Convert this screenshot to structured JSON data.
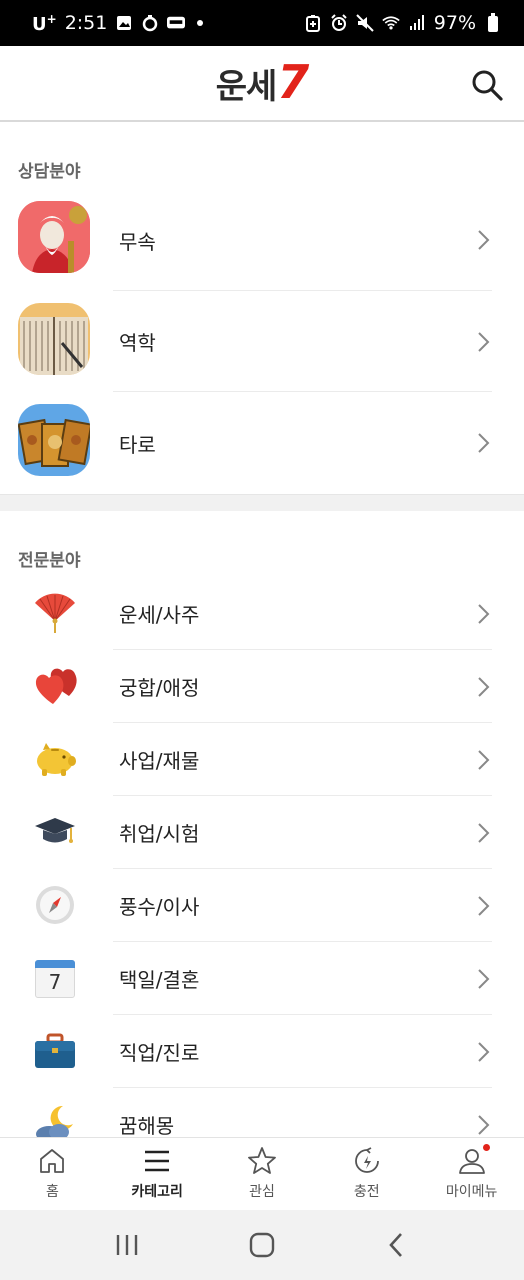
{
  "status_bar": {
    "carrier": "U",
    "carrier_sup": "+",
    "time": "2:51",
    "battery": "97%"
  },
  "header": {
    "logo_text": "운세",
    "logo_number": "7"
  },
  "section_consult": {
    "title": "상담분야",
    "items": [
      {
        "label": "무속"
      },
      {
        "label": "역학"
      },
      {
        "label": "타로"
      }
    ]
  },
  "section_expert": {
    "title": "전문분야",
    "items": [
      {
        "label": "운세/사주",
        "icon": "folding-fan-icon"
      },
      {
        "label": "궁합/애정",
        "icon": "two-hearts-icon"
      },
      {
        "label": "사업/재물",
        "icon": "piggy-bank-icon"
      },
      {
        "label": "취업/시험",
        "icon": "graduation-cap-icon"
      },
      {
        "label": "풍수/이사",
        "icon": "compass-icon"
      },
      {
        "label": "택일/결혼",
        "icon": "calendar-icon",
        "icon_text": "7"
      },
      {
        "label": "직업/진로",
        "icon": "briefcase-icon"
      },
      {
        "label": "꿈해몽",
        "icon": "moon-cloud-icon"
      }
    ]
  },
  "bottom_nav": {
    "items": [
      {
        "label": "홈",
        "icon": "home-icon"
      },
      {
        "label": "카테고리",
        "icon": "menu-icon",
        "active": true
      },
      {
        "label": "관심",
        "icon": "star-icon"
      },
      {
        "label": "충전",
        "icon": "clock-charge-icon"
      },
      {
        "label": "마이메뉴",
        "icon": "person-icon"
      }
    ]
  },
  "colors": {
    "brand_red": "#e2231a",
    "text": "#222222",
    "section_title": "#666666",
    "divider": "#f1f1f1"
  }
}
